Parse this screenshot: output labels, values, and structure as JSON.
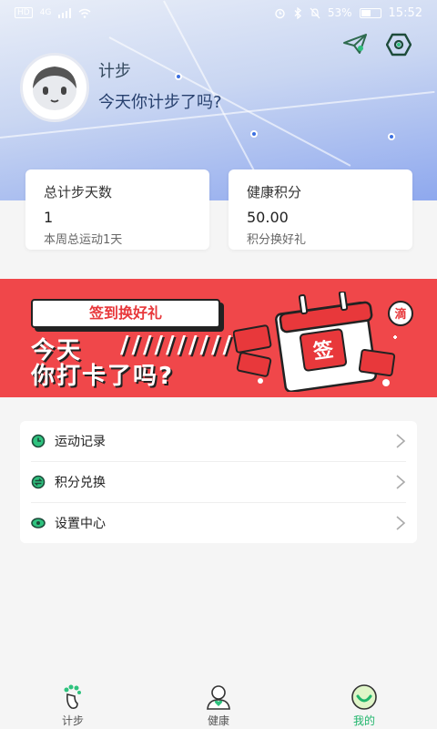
{
  "status_bar": {
    "left_badge": "HD",
    "network": "4G",
    "battery_percent": "53%",
    "battery_level": 0.53,
    "time": "15:52"
  },
  "header": {
    "app_name": "计步",
    "slogan": "今天你计步了吗?",
    "icons": [
      "send-icon",
      "settings-icon",
      "avatar"
    ]
  },
  "stats": [
    {
      "title": "总计步天数",
      "value": "1",
      "sub": "本周总运动1天"
    },
    {
      "title": "健康积分",
      "value": "50.00",
      "sub": "积分换好礼"
    }
  ],
  "banner": {
    "pill": "签到换好礼",
    "line1": "今天",
    "slashes": "//////////",
    "line2": "你打卡了吗?",
    "calendar_char": "签",
    "bubble_char": "滴",
    "colors": {
      "background": "#f0474a",
      "accent": "#e8383b"
    }
  },
  "menu": {
    "items": [
      {
        "label": "运动记录",
        "icon": "clock-icon"
      },
      {
        "label": "积分兑换",
        "icon": "exchange-icon"
      },
      {
        "label": "设置中心",
        "icon": "eye-icon"
      }
    ]
  },
  "bottom_nav": {
    "tabs": [
      {
        "label": "计步",
        "icon": "footprint-icon"
      },
      {
        "label": "健康",
        "icon": "person-icon"
      },
      {
        "label": "我的",
        "icon": "smile-icon",
        "active": true
      }
    ],
    "active_color": "#1fb56b"
  }
}
